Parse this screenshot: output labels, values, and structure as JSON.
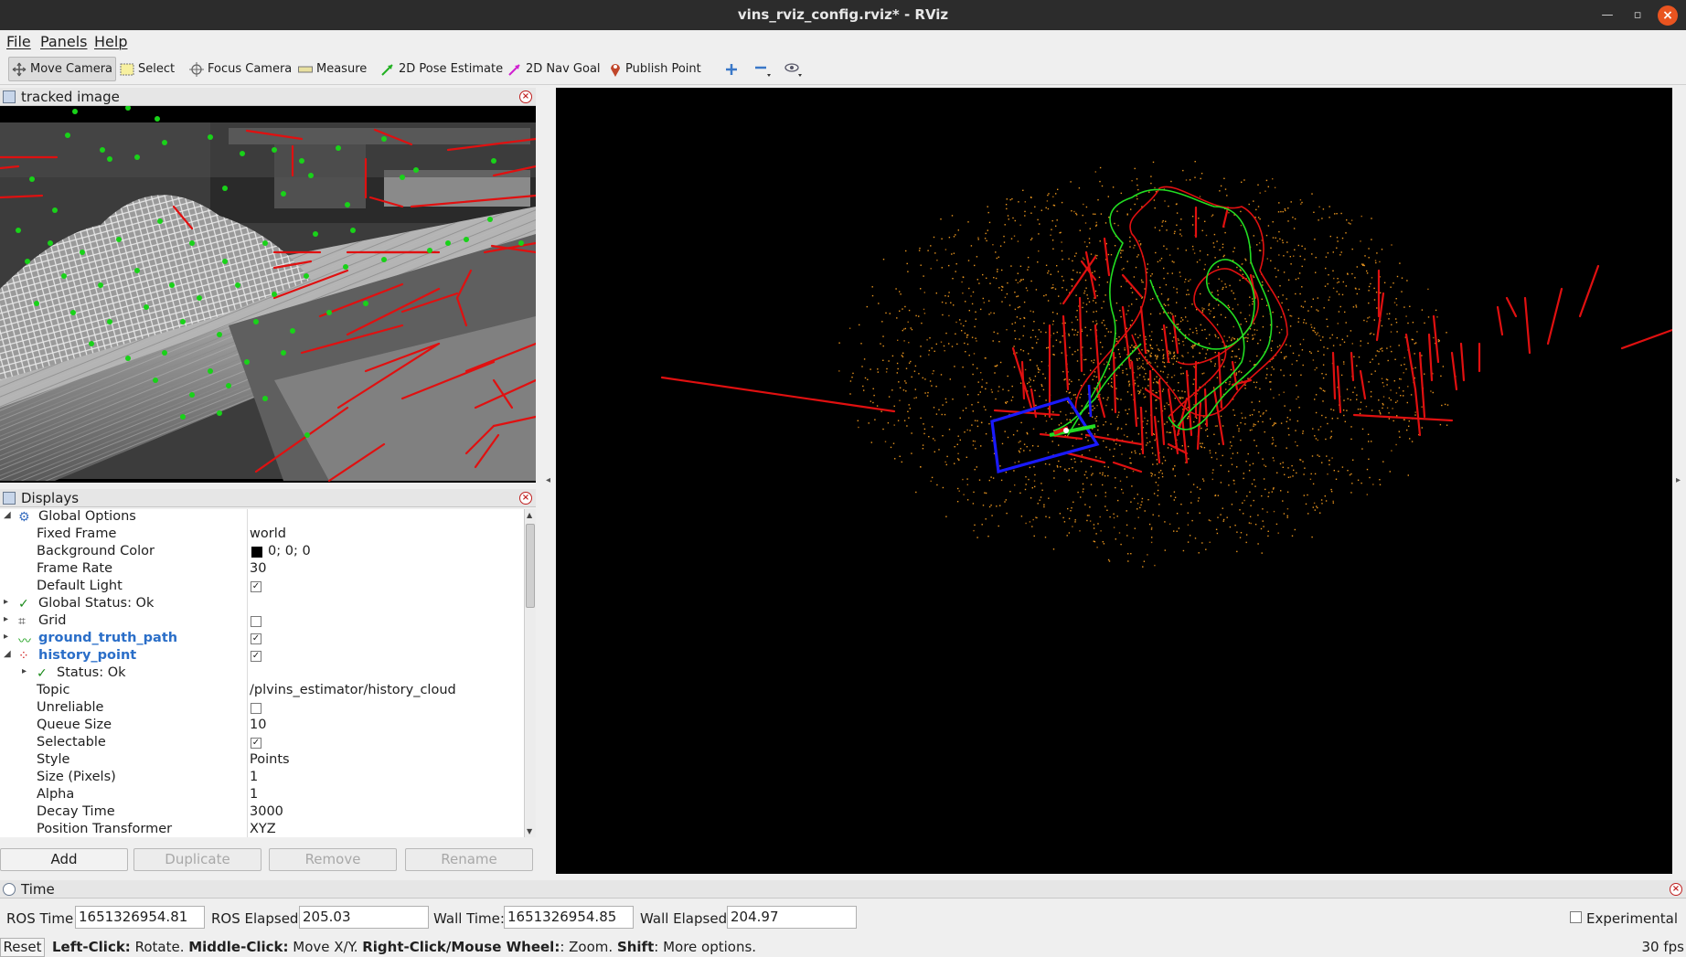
{
  "window": {
    "title": "vins_rviz_config.rviz* - RViz"
  },
  "menu": {
    "file": "File",
    "panels": "Panels",
    "help": "Help"
  },
  "toolbar": {
    "move_camera": "Move Camera",
    "select": "Select",
    "focus_camera": "Focus Camera",
    "measure": "Measure",
    "pose_estimate": "2D Pose Estimate",
    "nav_goal": "2D Nav Goal",
    "publish_point": "Publish Point"
  },
  "image_panel": {
    "title": "tracked image"
  },
  "displays": {
    "title": "Displays",
    "rows": [
      {
        "label": "Global Options",
        "value": ""
      },
      {
        "label": "Fixed Frame",
        "value": "world"
      },
      {
        "label": "Background Color",
        "value": "0; 0; 0"
      },
      {
        "label": "Frame Rate",
        "value": "30"
      },
      {
        "label": "Default Light",
        "value": ""
      },
      {
        "label": "Global Status: Ok",
        "value": ""
      },
      {
        "label": "Grid",
        "value": ""
      },
      {
        "label": "ground_truth_path",
        "value": ""
      },
      {
        "label": "history_point",
        "value": ""
      },
      {
        "label": "Status: Ok",
        "value": ""
      },
      {
        "label": "Topic",
        "value": "/plvins_estimator/history_cloud"
      },
      {
        "label": "Unreliable",
        "value": ""
      },
      {
        "label": "Queue Size",
        "value": "10"
      },
      {
        "label": "Selectable",
        "value": ""
      },
      {
        "label": "Style",
        "value": "Points"
      },
      {
        "label": "Size (Pixels)",
        "value": "1"
      },
      {
        "label": "Alpha",
        "value": "1"
      },
      {
        "label": "Decay Time",
        "value": "3000"
      },
      {
        "label": "Position Transformer",
        "value": "XYZ"
      }
    ],
    "checks": {
      "default_light": true,
      "grid": false,
      "ground_truth_path": true,
      "history_point": true,
      "unreliable": false,
      "selectable": true
    },
    "background_color_hex": "#000000",
    "buttons": {
      "add": "Add",
      "duplicate": "Duplicate",
      "remove": "Remove",
      "rename": "Rename"
    }
  },
  "time": {
    "title": "Time",
    "ros_time_label": "ROS Time:",
    "ros_time": "1651326954.81",
    "ros_elapsed_label": "ROS Elapsed:",
    "ros_elapsed": "205.03",
    "wall_time_label": "Wall Time:",
    "wall_time": "1651326954.85",
    "wall_elapsed_label": "Wall Elapsed:",
    "wall_elapsed": "204.97",
    "experimental_label": "Experimental"
  },
  "status_bar": {
    "reset": "Reset",
    "k1": "Left-Click:",
    "v1": " Rotate. ",
    "k2": "Middle-Click:",
    "v2": " Move X/Y. ",
    "k3": "Right-Click/Mouse Wheel:",
    "v3": ": Zoom. ",
    "k4": "Shift",
    "v4": ": More options.",
    "fps": "30 fps"
  },
  "colors": {
    "accent": "#2a6ec8",
    "close": "#e95420",
    "feature": "#19d219",
    "line": "#e01010",
    "cloud": "#e8941e",
    "camera": "#1a1aff"
  }
}
